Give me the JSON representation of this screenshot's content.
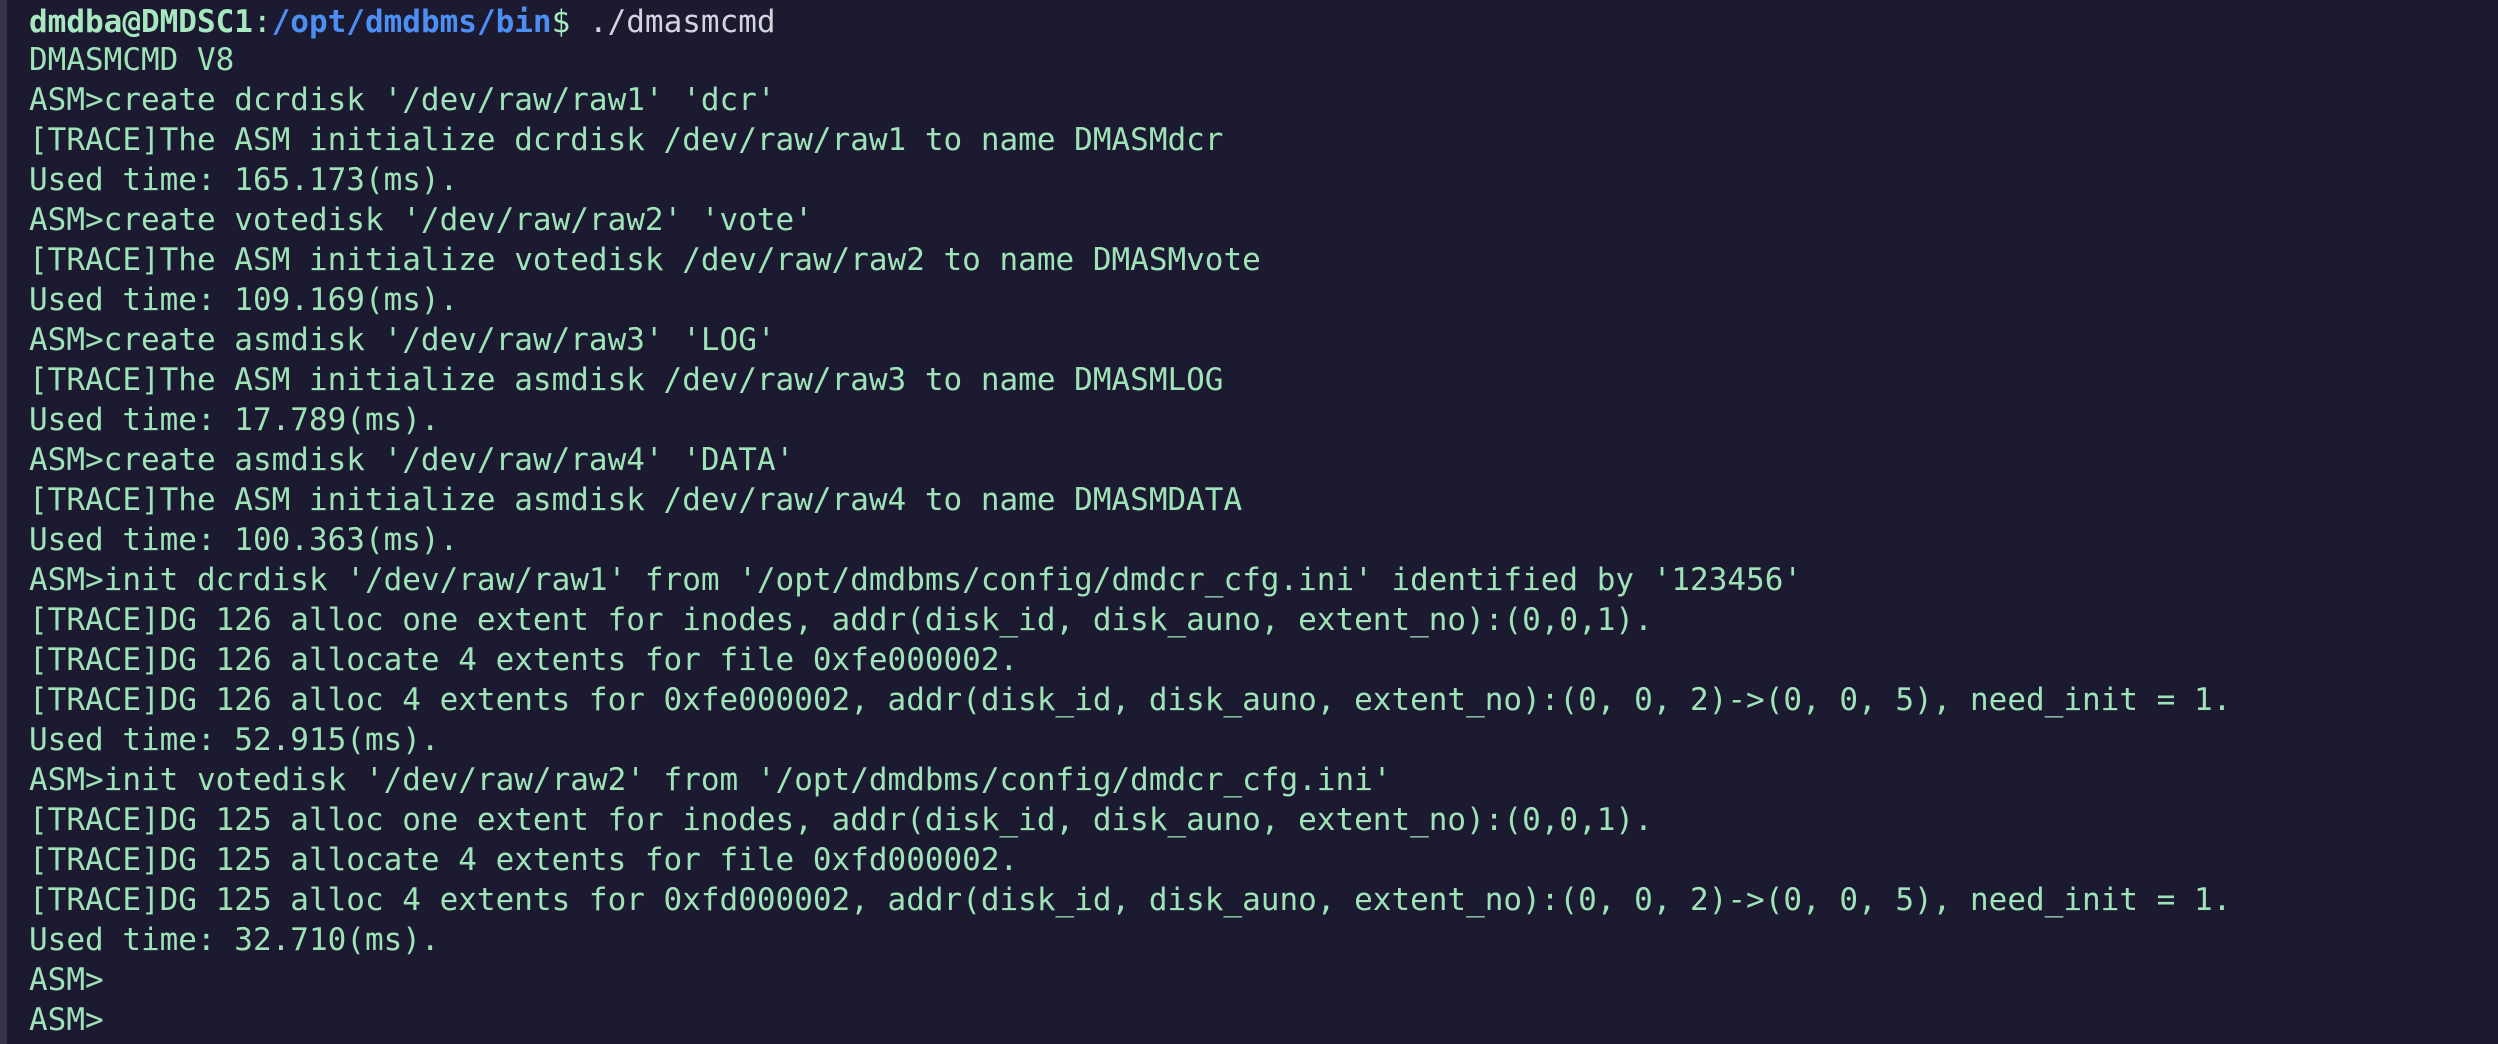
{
  "prompt": {
    "user_host": "dmdba@DMDSC1",
    "colon": ":",
    "path": "/opt/dmdbms/bin",
    "dollar": "$ ",
    "command": "./dmasmcmd"
  },
  "output_lines": [
    "DMASMCMD V8",
    "ASM>create dcrdisk '/dev/raw/raw1' 'dcr'",
    "[TRACE]The ASM initialize dcrdisk /dev/raw/raw1 to name DMASMdcr",
    "Used time: 165.173(ms).",
    "ASM>create votedisk '/dev/raw/raw2' 'vote'",
    "[TRACE]The ASM initialize votedisk /dev/raw/raw2 to name DMASMvote",
    "Used time: 109.169(ms).",
    "ASM>create asmdisk '/dev/raw/raw3' 'LOG'",
    "[TRACE]The ASM initialize asmdisk /dev/raw/raw3 to name DMASMLOG",
    "Used time: 17.789(ms).",
    "ASM>create asmdisk '/dev/raw/raw4' 'DATA'",
    "[TRACE]The ASM initialize asmdisk /dev/raw/raw4 to name DMASMDATA",
    "Used time: 100.363(ms).",
    "ASM>init dcrdisk '/dev/raw/raw1' from '/opt/dmdbms/config/dmdcr_cfg.ini' identified by '123456'",
    "[TRACE]DG 126 alloc one extent for inodes, addr(disk_id, disk_auno, extent_no):(0,0,1).",
    "[TRACE]DG 126 allocate 4 extents for file 0xfe000002.",
    "[TRACE]DG 126 alloc 4 extents for 0xfe000002, addr(disk_id, disk_auno, extent_no):(0, 0, 2)->(0, 0, 5), need_init = 1.",
    "Used time: 52.915(ms).",
    "ASM>init votedisk '/dev/raw/raw2' from '/opt/dmdbms/config/dmdcr_cfg.ini'",
    "[TRACE]DG 125 alloc one extent for inodes, addr(disk_id, disk_auno, extent_no):(0,0,1).",
    "[TRACE]DG 125 allocate 4 extents for file 0xfd000002.",
    "[TRACE]DG 125 alloc 4 extents for 0xfd000002, addr(disk_id, disk_auno, extent_no):(0, 0, 2)->(0, 0, 5), need_init = 1.",
    "Used time: 32.710(ms).",
    "ASM>",
    "ASM>"
  ],
  "colors": {
    "background": "#1b1a30",
    "text": "#9fe3b8",
    "path": "#4d8ef2"
  }
}
